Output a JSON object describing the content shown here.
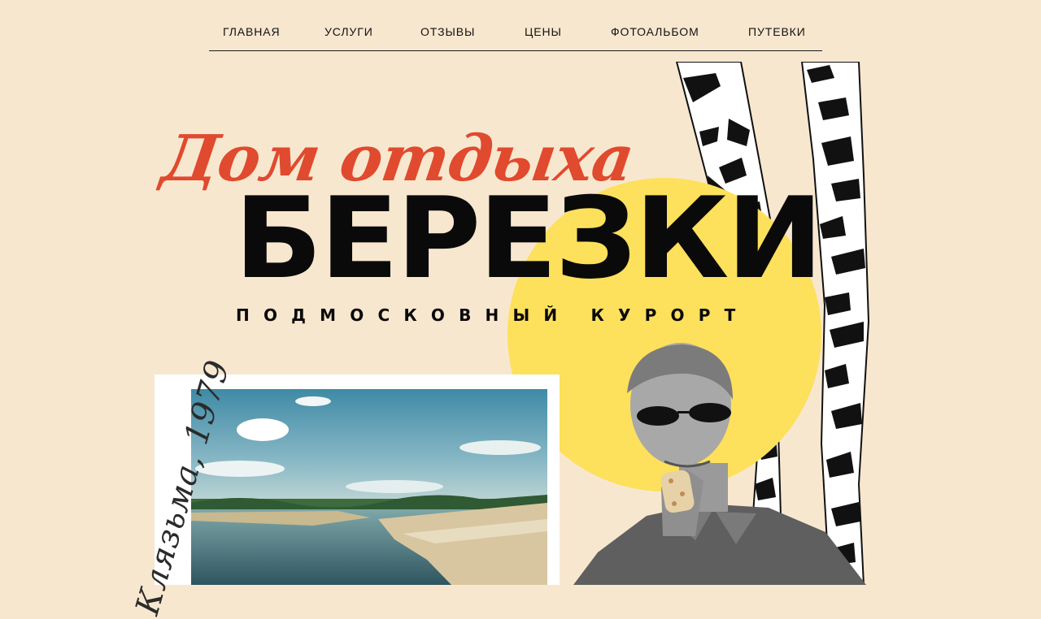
{
  "nav": {
    "items": [
      {
        "label": "ГЛАВНАЯ"
      },
      {
        "label": "УСЛУГИ"
      },
      {
        "label": "ОТЗЫВЫ"
      },
      {
        "label": "ЦЕНЫ"
      },
      {
        "label": "ФОТОАЛЬБОМ"
      },
      {
        "label": "ПУТЕВКИ"
      }
    ]
  },
  "hero": {
    "script_title": "Дом отдыха",
    "main_title": "БЕРЕЗКИ",
    "subtitle": "ПОДМОСКОВНЫЙ КУРОРТ"
  },
  "photo": {
    "caption": "Клязьма, 1979"
  },
  "colors": {
    "background": "#f8e7cf",
    "accent_red": "#e04a2e",
    "sun_yellow": "#fde05c",
    "text_dark": "#0a0a0a"
  },
  "icons": {
    "birch": "birch-trees-illustration",
    "sun": "yellow-sun-circle",
    "man": "man-with-sunglasses-and-ice-cream"
  }
}
